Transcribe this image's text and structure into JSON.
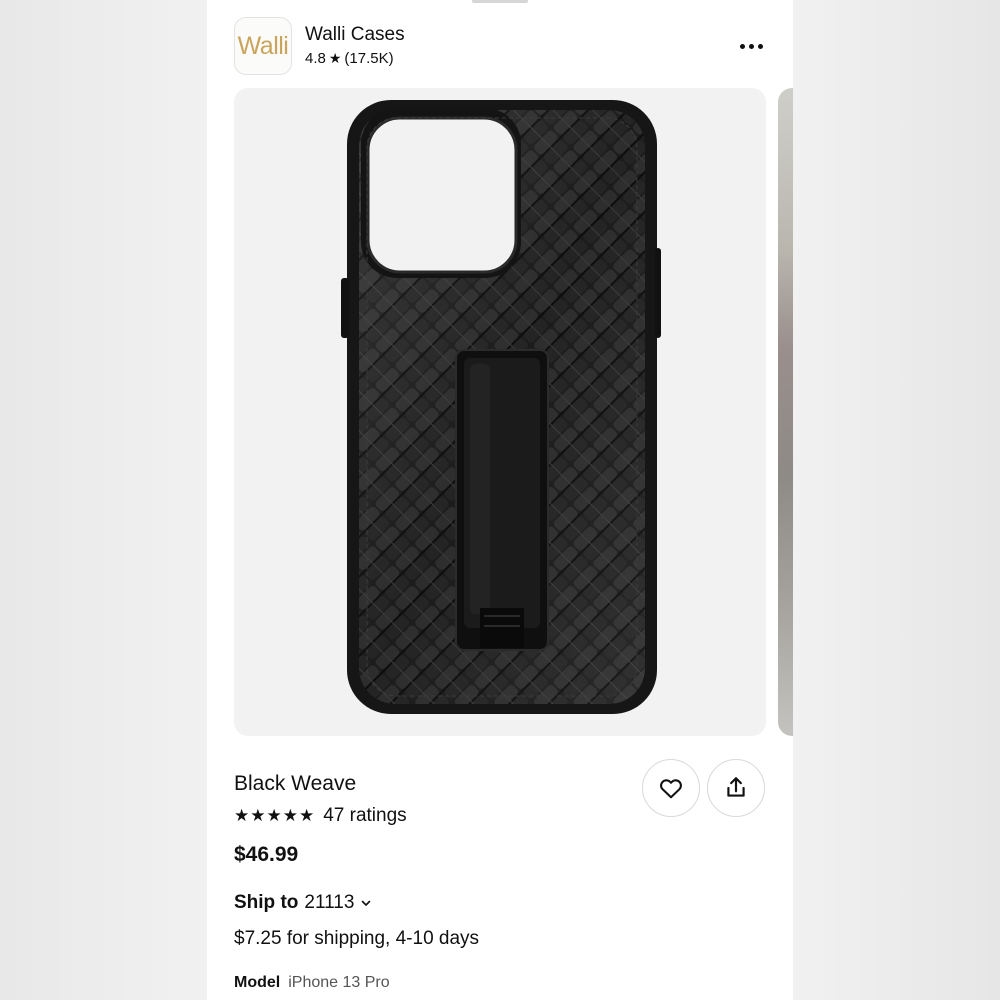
{
  "seller": {
    "logo_text": "Walli",
    "name": "Walli Cases",
    "rating": "4.8",
    "rating_count": "(17.5K)"
  },
  "product": {
    "title": "Black Weave",
    "stars": "★★★★★",
    "ratings_label": "47 ratings",
    "price": "$46.99",
    "ship_label": "Ship to",
    "ship_zip": "21113",
    "shipping_text": "$7.25 for shipping, 4-10 days",
    "model_label": "Model",
    "model_value": "iPhone 13 Pro"
  },
  "icons": {
    "more": "more-horizontal-icon",
    "favorite": "heart-icon",
    "share": "share-icon",
    "chevron": "chevron-down-icon"
  },
  "colors": {
    "logo_gold": "#c9a45a",
    "case_black": "#1a1a1a",
    "card_bg": "#f2f2f2"
  }
}
